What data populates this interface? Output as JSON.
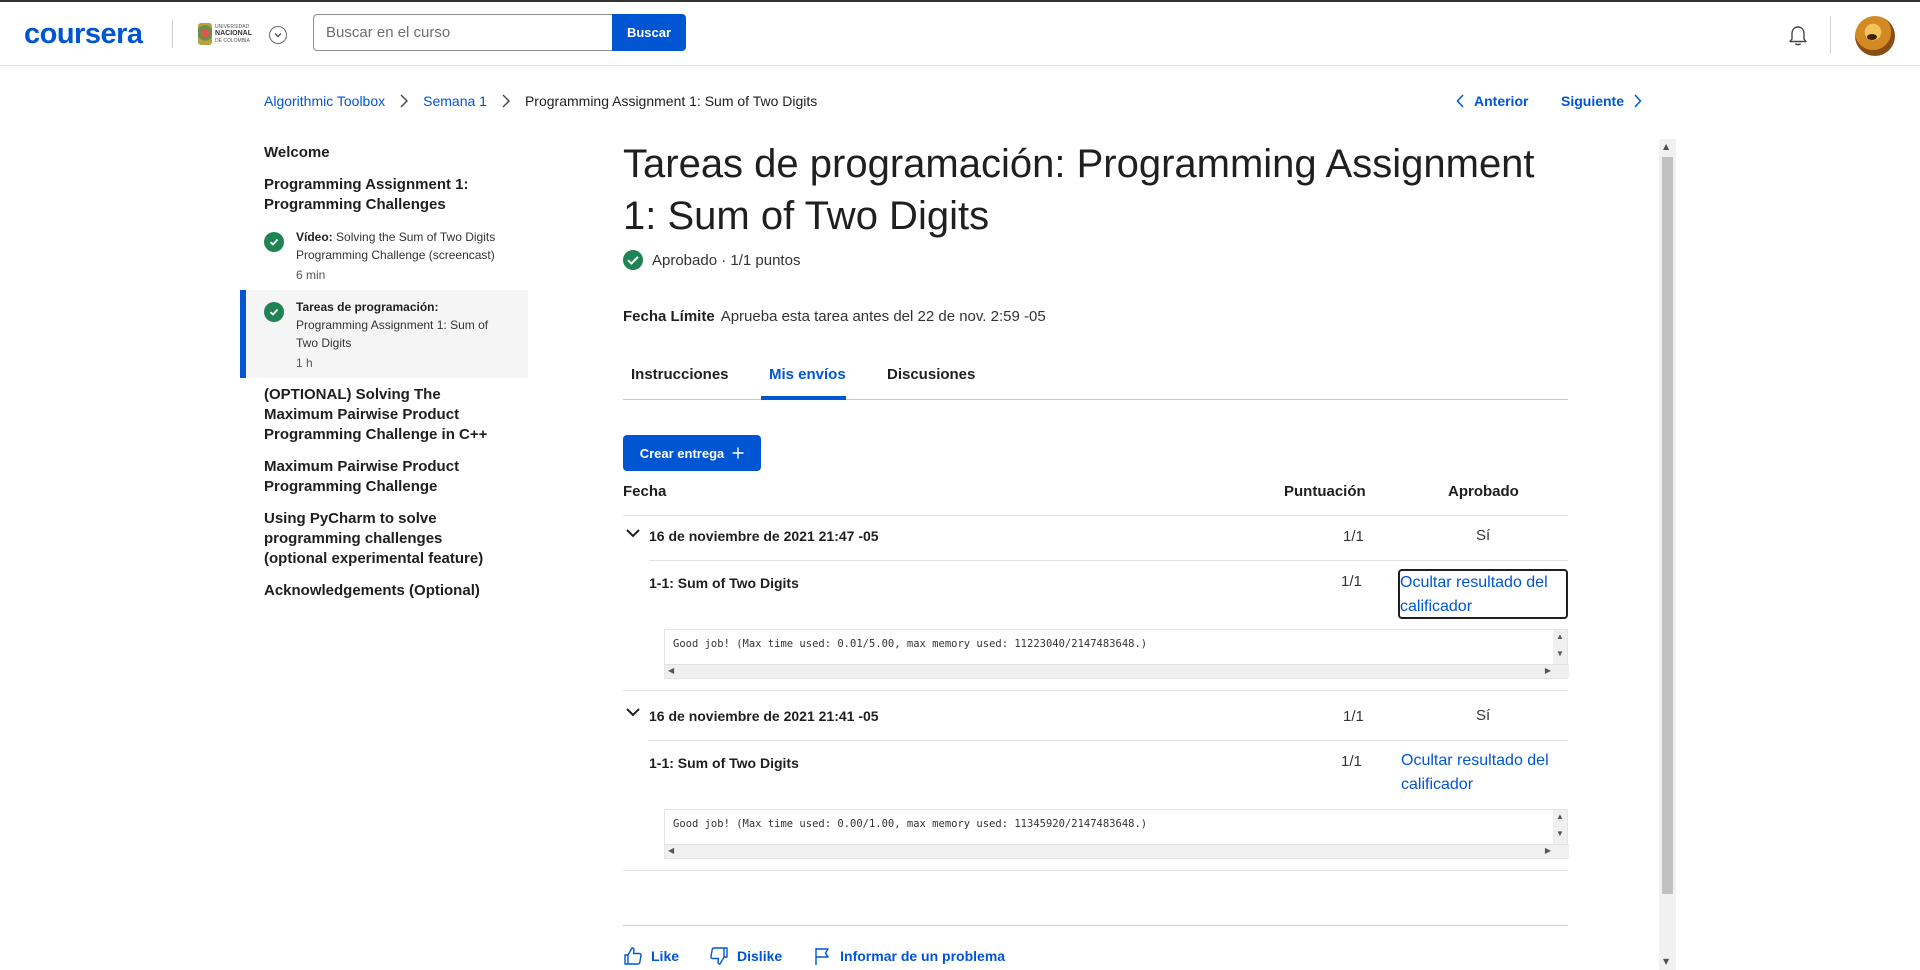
{
  "header": {
    "logo": "coursera",
    "university": {
      "line1": "UNIVERSIDAD",
      "line2": "NACIONAL",
      "line3": "DE COLOMBIA"
    },
    "search_placeholder": "Buscar en el curso",
    "search_button": "Buscar",
    "icons": [
      "chevron-down-icon",
      "bell-icon",
      "avatar"
    ]
  },
  "breadcrumb": {
    "items": [
      "Algorithmic Toolbox",
      "Semana 1",
      "Programming Assignment 1: Sum of Two Digits"
    ],
    "prev": "Anterior",
    "next": "Siguiente"
  },
  "sidebar": {
    "items": [
      {
        "label": "Welcome"
      },
      {
        "label": "Programming Assignment 1: Programming Challenges"
      },
      {
        "label": "(OPTIONAL) Solving The Maximum Pairwise Product Programming Challenge in C++"
      },
      {
        "label": "Maximum Pairwise Product Programming Challenge"
      },
      {
        "label": "Using PyCharm to solve programming challenges (optional experimental feature)"
      },
      {
        "label": "Acknowledgements (Optional)"
      }
    ],
    "subitems": [
      {
        "type": "Vídeo:",
        "title": "Solving the Sum of Two Digits Programming Challenge (screencast)",
        "duration": "6 min",
        "completed": true
      },
      {
        "type": "Tareas de programación:",
        "title": "Programming Assignment 1: Sum of Two Digits",
        "duration": "1 h",
        "completed": true,
        "active": true
      }
    ]
  },
  "main": {
    "title": "Tareas de programación: Programming Assignment 1: Sum of Two Digits",
    "status": "Aprobado · 1/1 puntos",
    "deadline_label": "Fecha Límite",
    "deadline_text": "Aprueba esta tarea antes del 22 de nov. 2:59 -05",
    "tabs": [
      "Instrucciones",
      "Mis envíos",
      "Discusiones"
    ],
    "active_tab": "Mis envíos",
    "create_button": "Crear entrega",
    "columns": [
      "Fecha",
      "Puntuación",
      "Aprobado"
    ],
    "submissions": [
      {
        "date": "16 de noviembre de 2021 21:47 -05",
        "score": "1/1",
        "passed": "Sí",
        "part": "1-1: Sum of Two Digits",
        "part_score": "1/1",
        "link": "Ocultar resultado del calificador",
        "output": "Good job! (Max time used: 0.01/5.00, max memory used: 11223040/2147483648.)"
      },
      {
        "date": "16 de noviembre de 2021 21:41 -05",
        "score": "1/1",
        "passed": "Sí",
        "part": "1-1: Sum of Two Digits",
        "part_score": "1/1",
        "link": "Ocultar resultado del calificador",
        "output": "Good job! (Max time used: 0.00/1.00, max memory used: 11345920/2147483648.)"
      }
    ],
    "footer": {
      "like": "Like",
      "dislike": "Dislike",
      "report": "Informar de un problema"
    }
  },
  "colors": {
    "accent": "#0056d2",
    "success": "#1f8354",
    "text": "#1f1f1f"
  }
}
